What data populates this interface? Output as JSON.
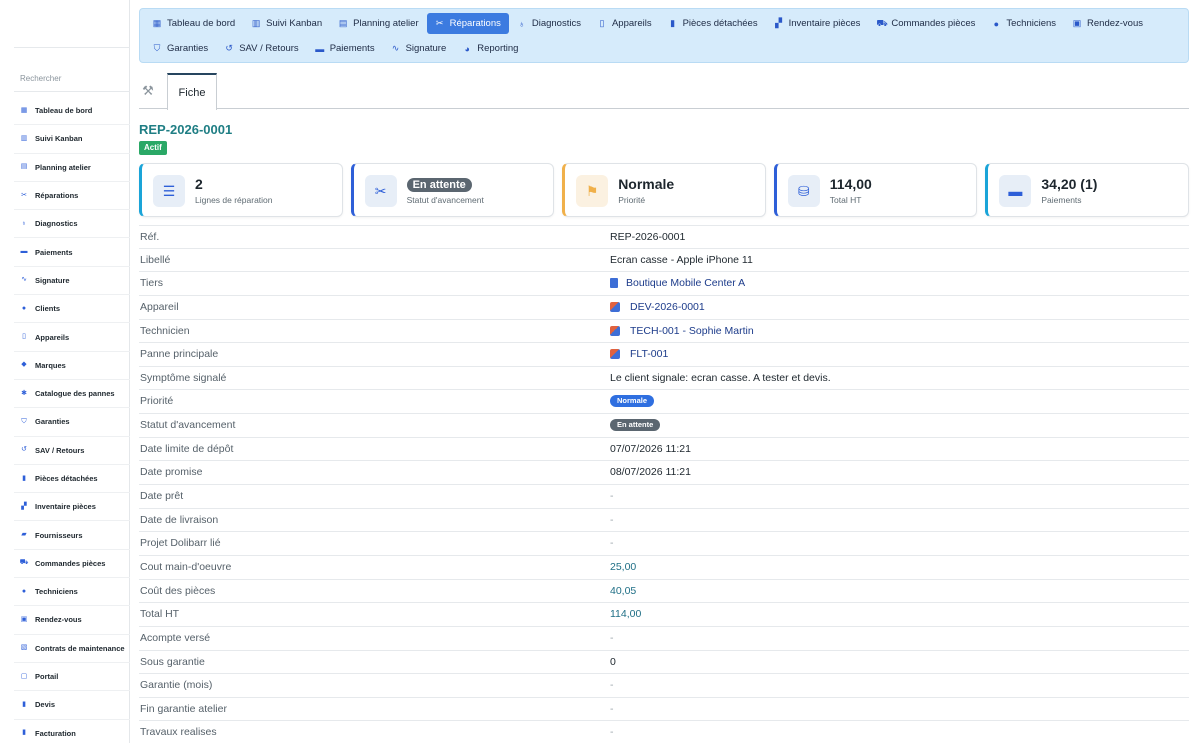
{
  "sidebar": {
    "search_label": "Rechercher",
    "items": [
      {
        "label": "Tableau de bord",
        "icon": "grid-icon"
      },
      {
        "label": "Suivi Kanban",
        "icon": "kanban-icon"
      },
      {
        "label": "Planning atelier",
        "icon": "calendar-icon"
      },
      {
        "label": "Réparations",
        "icon": "tools-icon"
      },
      {
        "label": "Diagnostics",
        "icon": "stethoscope-icon"
      },
      {
        "label": "Paiements",
        "icon": "money-icon"
      },
      {
        "label": "Signature",
        "icon": "signature-icon"
      },
      {
        "label": "Clients",
        "icon": "user-icon"
      },
      {
        "label": "Appareils",
        "icon": "phone-icon"
      },
      {
        "label": "Marques",
        "icon": "tag-icon"
      },
      {
        "label": "Catalogue des pannes",
        "icon": "bug-icon"
      },
      {
        "label": "Garanties",
        "icon": "shield-icon"
      },
      {
        "label": "SAV / Retours",
        "icon": "undo-icon"
      },
      {
        "label": "Pièces détachées",
        "icon": "microchip-icon"
      },
      {
        "label": "Inventaire pièces",
        "icon": "boxes-icon"
      },
      {
        "label": "Fournisseurs",
        "icon": "truck-icon"
      },
      {
        "label": "Commandes pièces",
        "icon": "cart-icon"
      },
      {
        "label": "Techniciens",
        "icon": "user-gear-icon"
      },
      {
        "label": "Rendez-vous",
        "icon": "calendar-check-icon"
      },
      {
        "label": "Contrats de maintenance",
        "icon": "contract-icon"
      },
      {
        "label": "Portail",
        "icon": "portal-icon"
      },
      {
        "label": "Devis",
        "icon": "file-icon"
      },
      {
        "label": "Facturation",
        "icon": "invoice-icon"
      }
    ]
  },
  "topnav": {
    "row1": [
      {
        "label": "Tableau de bord",
        "icon": "grid-icon",
        "active": false
      },
      {
        "label": "Suivi Kanban",
        "icon": "kanban-icon",
        "active": false
      },
      {
        "label": "Planning atelier",
        "icon": "calendar-icon",
        "active": false
      },
      {
        "label": "Réparations",
        "icon": "tools-icon",
        "active": true
      },
      {
        "label": "Diagnostics",
        "icon": "stethoscope-icon",
        "active": false
      },
      {
        "label": "Appareils",
        "icon": "phone-icon",
        "active": false
      },
      {
        "label": "Pièces détachées",
        "icon": "microchip-icon",
        "active": false
      },
      {
        "label": "Inventaire pièces",
        "icon": "boxes-icon",
        "active": false
      },
      {
        "label": "Commandes pièces",
        "icon": "cart-icon",
        "active": false
      },
      {
        "label": "Techniciens",
        "icon": "user-gear-icon",
        "active": false
      },
      {
        "label": "Rendez-vous",
        "icon": "calendar-check-icon",
        "active": false
      }
    ],
    "row2": [
      {
        "label": "Garanties",
        "icon": "shield-icon",
        "active": false
      },
      {
        "label": "SAV / Retours",
        "icon": "undo-icon",
        "active": false
      },
      {
        "label": "Paiements",
        "icon": "money-icon",
        "active": false
      },
      {
        "label": "Signature",
        "icon": "signature-icon",
        "active": false
      },
      {
        "label": "Reporting",
        "icon": "chart-pie-icon",
        "active": false
      }
    ]
  },
  "tabs": {
    "tool_icon": "tools-icon",
    "active_tab": "Fiche"
  },
  "record": {
    "ref": "REP-2026-0001",
    "status_badge": "Actif"
  },
  "cards": [
    {
      "value": "2",
      "label": "Lignes de réparation",
      "icon": "list-icon",
      "accent": "#1aa4d8",
      "pill": false
    },
    {
      "value": "En attente",
      "label": "Statut d'avancement",
      "icon": "tools-icon",
      "accent": "#2e5fd8",
      "pill": true
    },
    {
      "value": "Normale",
      "label": "Priorité",
      "icon": "flag-icon",
      "accent": "#f0b04a",
      "pill": false
    },
    {
      "value": "114,00",
      "label": "Total HT",
      "icon": "coins-icon",
      "accent": "#2e5fd8",
      "pill": false
    },
    {
      "value": "34,20 (1)",
      "label": "Paiements",
      "icon": "money-icon",
      "accent": "#1aa4d8",
      "pill": false
    }
  ],
  "fields": [
    {
      "label": "Réf.",
      "value": "REP-2026-0001",
      "kind": "text"
    },
    {
      "label": "Libellé",
      "value": "Ecran casse - Apple iPhone 11",
      "kind": "text"
    },
    {
      "label": "Tiers",
      "value": "Boutique Mobile Center A",
      "kind": "company"
    },
    {
      "label": "Appareil",
      "value": "DEV-2026-0001",
      "kind": "object"
    },
    {
      "label": "Technicien",
      "value": "TECH-001 - Sophie Martin",
      "kind": "object"
    },
    {
      "label": "Panne principale",
      "value": "FLT-001",
      "kind": "object"
    },
    {
      "label": "Symptôme signalé",
      "value": "Le client signale: ecran casse. A tester et devis.",
      "kind": "text"
    },
    {
      "label": "Priorité",
      "value": "Normale",
      "kind": "pill-blue"
    },
    {
      "label": "Statut d'avancement",
      "value": "En attente",
      "kind": "pill-grey"
    },
    {
      "label": "Date limite de dépôt",
      "value": "07/07/2026 11:21",
      "kind": "text"
    },
    {
      "label": "Date promise",
      "value": "08/07/2026 11:21",
      "kind": "text"
    },
    {
      "label": "Date prêt",
      "value": "-",
      "kind": "dash"
    },
    {
      "label": "Date de livraison",
      "value": "-",
      "kind": "dash"
    },
    {
      "label": "Projet Dolibarr lié",
      "value": "-",
      "kind": "dash"
    },
    {
      "label": "Cout main-d'oeuvre",
      "value": "25,00",
      "kind": "teal"
    },
    {
      "label": "Coût des pièces",
      "value": "40,05",
      "kind": "teal"
    },
    {
      "label": "Total HT",
      "value": "114,00",
      "kind": "teal"
    },
    {
      "label": "Acompte versé",
      "value": "-",
      "kind": "dash"
    },
    {
      "label": "Sous garantie",
      "value": "0",
      "kind": "text"
    },
    {
      "label": "Garantie (mois)",
      "value": "-",
      "kind": "dash"
    },
    {
      "label": "Fin garantie atelier",
      "value": "-",
      "kind": "dash"
    },
    {
      "label": "Travaux realises",
      "value": "-",
      "kind": "dash"
    }
  ]
}
